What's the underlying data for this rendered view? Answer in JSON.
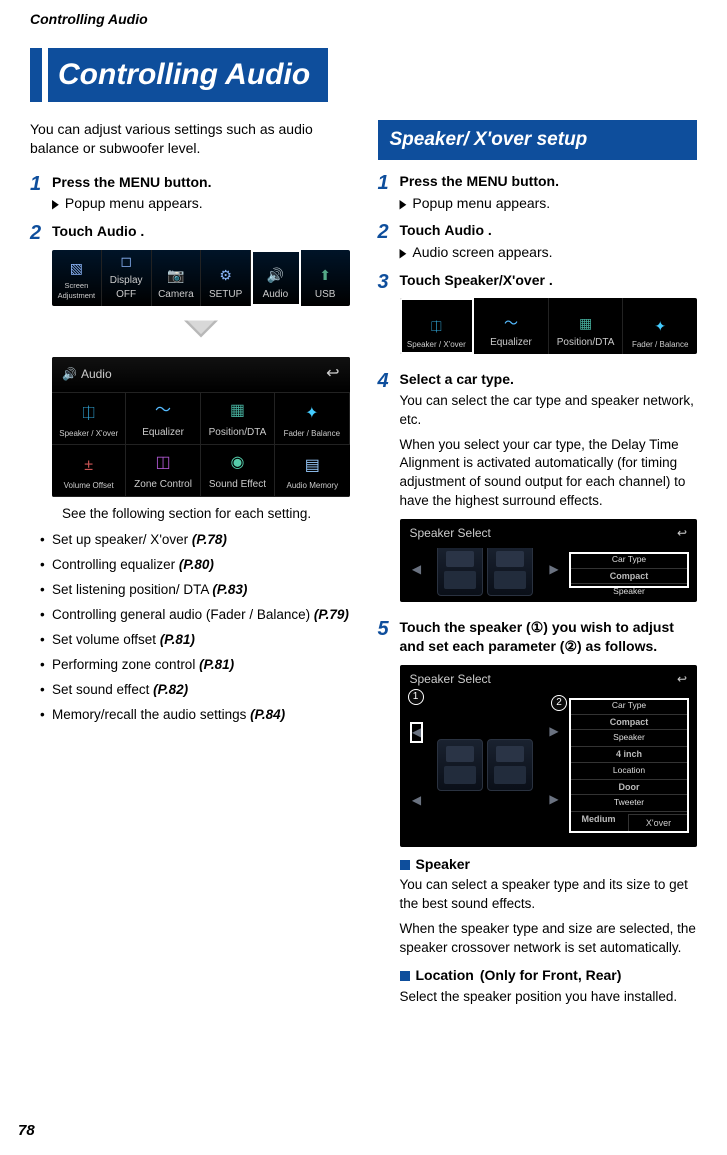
{
  "header": "Controlling Audio",
  "title": "Controlling Audio",
  "page_number": "78",
  "left": {
    "intro": "You can adjust various settings such as audio balance or subwoofer level.",
    "step1_num": "1",
    "step1_a": "Press the ",
    "step1_kw": "MENU",
    "step1_b": " button.",
    "step1_sub": "Popup menu appears.",
    "step2_num": "2",
    "step2_a": "Touch ",
    "step2_kw": "Audio",
    "step2_b": " .",
    "popup_tiles": [
      "Screen Adjustment",
      "Display OFF",
      "Camera",
      "SETUP",
      "Audio",
      "USB"
    ],
    "audio_header": "Audio",
    "audio_tiles": [
      "Speaker / X'over",
      "Equalizer",
      "Position/DTA",
      "Fader / Balance",
      "Volume Offset",
      "Zone Control",
      "Sound Effect",
      "Audio Memory"
    ],
    "note": "See the following section for each setting.",
    "bullets": [
      {
        "t": "Set up speaker/ X'over ",
        "p": "(P.78)"
      },
      {
        "t": "Controlling equalizer ",
        "p": "(P.80)"
      },
      {
        "t": "Set listening position/ DTA ",
        "p": "(P.83)"
      },
      {
        "t": "Controlling general audio (Fader / Balance) ",
        "p": "(P.79)"
      },
      {
        "t": "Set volume offset ",
        "p": "(P.81)"
      },
      {
        "t": "Performing zone control ",
        "p": "(P.81)"
      },
      {
        "t": "Set sound effect ",
        "p": "(P.82)"
      },
      {
        "t": "Memory/recall the audio settings ",
        "p": "(P.84)"
      }
    ]
  },
  "right": {
    "section": "Speaker/ X'over setup",
    "step1_num": "1",
    "step1_a": "Press the ",
    "step1_kw": "MENU",
    "step1_b": " button.",
    "step1_sub": "Popup menu appears.",
    "step2_num": "2",
    "step2_a": "Touch ",
    "step2_kw": "Audio",
    "step2_b": " .",
    "step2_sub": "Audio screen appears.",
    "step3_num": "3",
    "step3_a": "Touch ",
    "step3_kw": "Speaker/X'over",
    "step3_b": " .",
    "audio_tiles": [
      "Speaker / X'over",
      "Equalizer",
      "Position/DTA",
      "Fader / Balance"
    ],
    "step4_num": "4",
    "step4_title": "Select a car type.",
    "step4_p1": "You can select the car type and speaker network, etc.",
    "step4_p2": "When you select your car type, the Delay Time Alignment is activated automatically (for timing adjustment of sound output for each channel) to have the highest surround effects.",
    "ss1_header": "Speaker Select",
    "ss1_params": {
      "l1": "Car Type",
      "v1": "Compact",
      "l2": "Speaker"
    },
    "step5_num": "5",
    "step5_text": "Touch the speaker (①) you wish to adjust and set each parameter (②) as follows.",
    "ss2_header": "Speaker Select",
    "ss2_params": {
      "l1": "Car Type",
      "v1": "Compact",
      "l2": "Speaker",
      "v2": "4 inch",
      "l3": "Location",
      "v3": "Door",
      "l4": "Tweeter",
      "v4": "Medium",
      "xover": "X'over"
    },
    "callout1": "1",
    "callout2": "2",
    "sp_title": "Speaker",
    "sp_p1": "You can select a speaker type and its size to get the best sound effects.",
    "sp_p2": "When the speaker type and size are selected, the speaker crossover network is set automatically.",
    "loc_title": "Location",
    "loc_extra": " (Only for Front, Rear)",
    "loc_p": "Select the speaker position you have installed."
  }
}
